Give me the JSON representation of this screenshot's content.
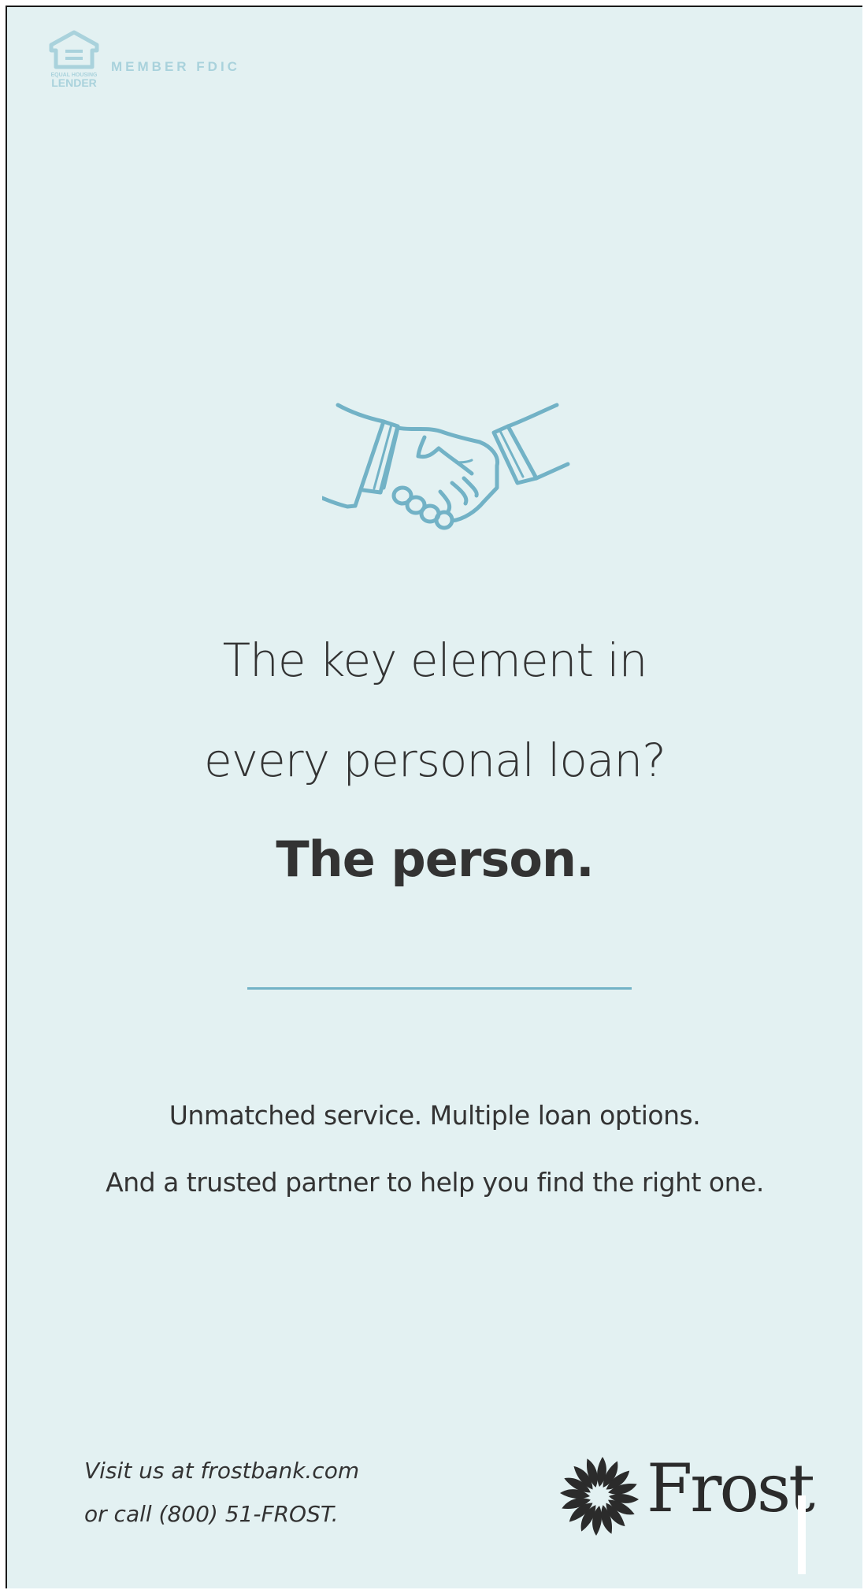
{
  "header": {
    "equal_housing_logo_text": "EQUAL HOUSING LENDER",
    "member_fdic": "MEMBER FDIC"
  },
  "headline": {
    "line1": "The key element in",
    "line2": "every personal loan?",
    "line3": "The person."
  },
  "body": {
    "line1": "Unmatched service. Multiple loan options.",
    "line2": "And a trusted partner to help you find the right one."
  },
  "footer": {
    "visit_line": "Visit us at frostbank.com",
    "call_line": "or call (800) 51-FROST.",
    "brand_name": "Frost"
  },
  "colors": {
    "background": "#e3f1f2",
    "accent_blue": "#72b2c6",
    "text_dark": "#333333",
    "fdic_light_blue": "#a9d2dc"
  },
  "icons": [
    "equal-housing-lender-icon",
    "handshake-icon",
    "frost-starburst-icon"
  ]
}
